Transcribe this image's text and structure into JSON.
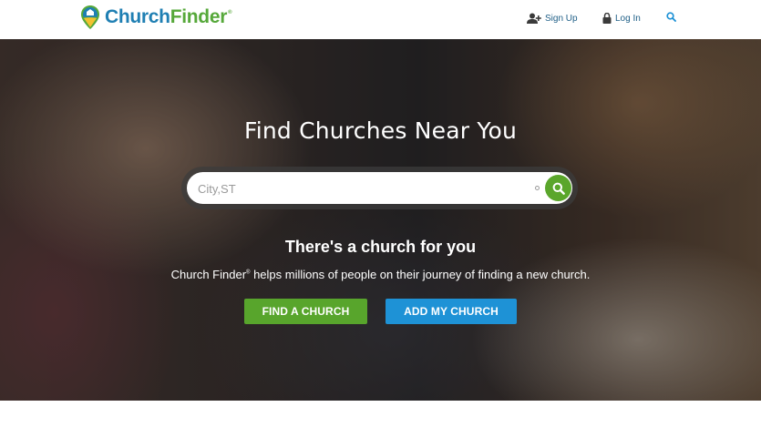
{
  "brand": {
    "name_part1": "Church",
    "name_part2": "Finder",
    "reg": "®",
    "colors": {
      "blue": "#1f7fb3",
      "green": "#56a83a"
    }
  },
  "nav": {
    "signup_label": "Sign Up",
    "login_label": "Log In",
    "signup_icon": "add-user-icon",
    "login_icon": "lock-icon",
    "search_icon": "search-icon"
  },
  "hero": {
    "title": "Find Churches Near You",
    "search": {
      "placeholder": "City,ST",
      "value": ""
    },
    "tagline": "There's a church for you",
    "subline_brand": "Church Finder",
    "subline_reg": "®",
    "subline_rest": " helps millions of people on their journey of finding a new church.",
    "find_button": "FIND A CHURCH",
    "add_button": "ADD MY CHURCH",
    "colors": {
      "find": "#58a52c",
      "add": "#1e92d6"
    }
  }
}
